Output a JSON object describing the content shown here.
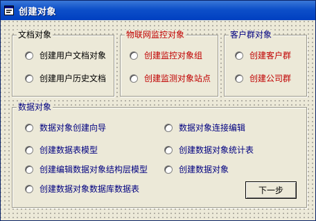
{
  "window": {
    "title": "创建对象"
  },
  "groups": {
    "document": {
      "legend": "文档对象",
      "options": [
        "创建用户文档对象",
        "创建用户历史文档"
      ]
    },
    "iot": {
      "legend": "物联网监控对象",
      "options": [
        "创建监控对象组",
        "创建监测对象站点"
      ]
    },
    "customer": {
      "legend": "客户群对象",
      "options": [
        "创建客户群",
        "创建公司群"
      ]
    },
    "data": {
      "legend": "数据对象",
      "options": [
        "数据对象创建向导",
        "数据对象连接编辑",
        "创建数据表模型",
        "创建数据对象统计表",
        "创建编辑数据对象结构层模型",
        "创建数据对象",
        "创建数据对象数据库数据表"
      ]
    }
  },
  "buttons": {
    "next": "下一步"
  },
  "colors": {
    "titlebar": "#0d4fc9",
    "red_text": "#c00000",
    "blue_text": "#000080"
  }
}
